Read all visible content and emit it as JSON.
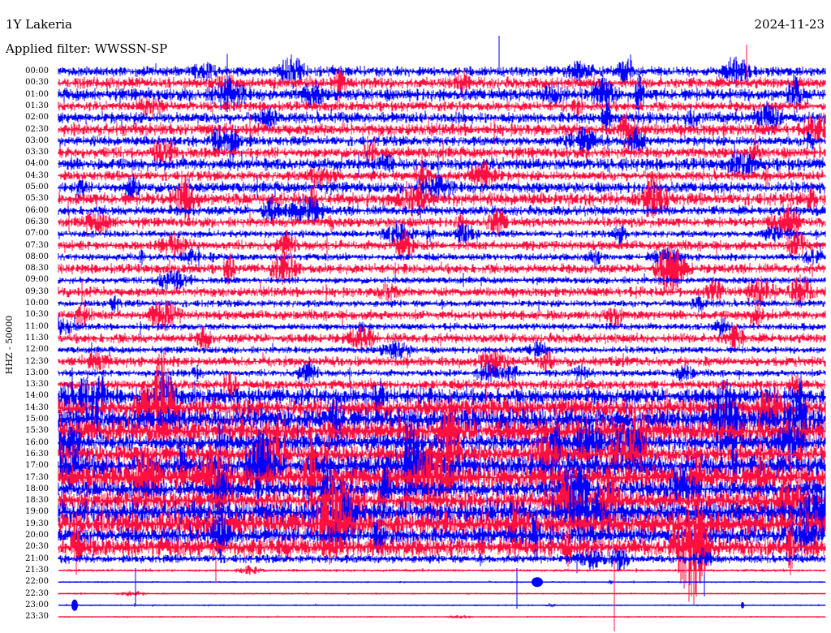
{
  "header": {
    "station": "1Y Lakeria",
    "date": "2024-11-23",
    "filter": "Applied filter: WWSSN-SP"
  },
  "axis": {
    "channel_label": "HHZ - 50000"
  },
  "trace_colors": [
    "#0000ff",
    "#ff1040"
  ],
  "time_labels": [
    "00:00",
    "00:30",
    "01:00",
    "01:30",
    "02:00",
    "02:30",
    "03:00",
    "03:30",
    "04:00",
    "04:30",
    "05:00",
    "05:30",
    "06:00",
    "06:30",
    "07:00",
    "07:30",
    "08:00",
    "08:30",
    "09:00",
    "09:30",
    "10:00",
    "10:30",
    "11:00",
    "11:30",
    "12:00",
    "12:30",
    "13:00",
    "13:30",
    "14:00",
    "14:30",
    "15:00",
    "15:30",
    "16:00",
    "16:30",
    "17:00",
    "17:30",
    "18:00",
    "18:30",
    "19:00",
    "19:30",
    "20:00",
    "20:30",
    "21:00",
    "21:30",
    "22:00",
    "22:30",
    "23:00",
    "23:30"
  ]
}
